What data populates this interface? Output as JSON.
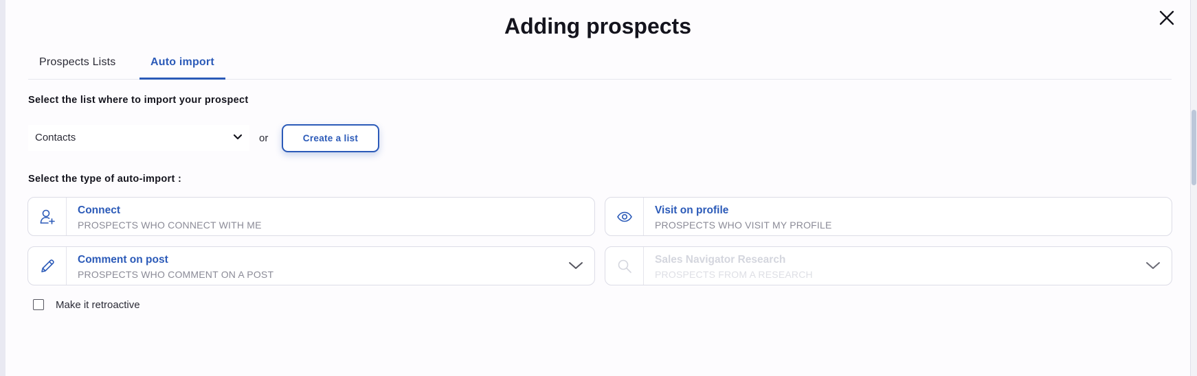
{
  "modal": {
    "title": "Adding prospects"
  },
  "tabs": [
    {
      "label": "Prospects Lists",
      "active": false
    },
    {
      "label": "Auto import",
      "active": true
    }
  ],
  "list_section": {
    "label": "Select the list where to import your prospect",
    "selected_list": "Contacts",
    "or_text": "or",
    "create_button": "Create a list"
  },
  "type_section": {
    "label": "Select the type of auto-import :",
    "options": [
      {
        "title": "Connect",
        "subtitle": "PROSPECTS WHO CONNECT WITH ME",
        "icon": "user-add-icon",
        "enabled": true
      },
      {
        "title": "Visit on profile",
        "subtitle": "PROSPECTS WHO VISIT MY PROFILE",
        "icon": "eye-icon",
        "enabled": true
      },
      {
        "title": "Comment on post",
        "subtitle": "PROSPECTS WHO COMMENT ON A POST",
        "icon": "pencil-icon",
        "enabled": true
      },
      {
        "title": "Sales Navigator Research",
        "subtitle": "PROSPECTS FROM A RESEARCH",
        "icon": "search-icon",
        "enabled": false
      }
    ]
  },
  "retroactive": {
    "label": "Make it retroactive",
    "checked": false
  },
  "colors": {
    "accent": "#2b5ab8",
    "text": "#14141d",
    "muted": "#8b8b97",
    "disabled": "#d4d6de"
  }
}
